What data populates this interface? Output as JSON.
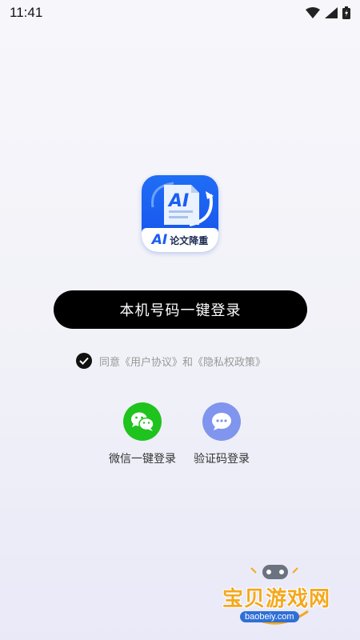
{
  "status_bar": {
    "time": "11:41",
    "icons": [
      "wifi-icon",
      "signal-icon",
      "battery-icon"
    ]
  },
  "app": {
    "icon_badge": "AI",
    "icon_title": "论文降重"
  },
  "login": {
    "button_label": "本机号码一键登录"
  },
  "agreement": {
    "checked": true,
    "prefix": "同意",
    "user_agreement": "《用户协议》",
    "joiner": "和",
    "privacy_policy": "《隐私权政策》"
  },
  "alt_login": [
    {
      "label": "微信一键登录",
      "icon": "wechat-icon",
      "color": "#1ec31e"
    },
    {
      "label": "验证码登录",
      "icon": "message-icon",
      "color": "#7f95ee"
    }
  ],
  "watermark": {
    "title": "宝贝游戏网",
    "url": "baobeiy.com"
  },
  "colors": {
    "button_bg": "#000000",
    "accent_blue": "#1b5ef2"
  }
}
